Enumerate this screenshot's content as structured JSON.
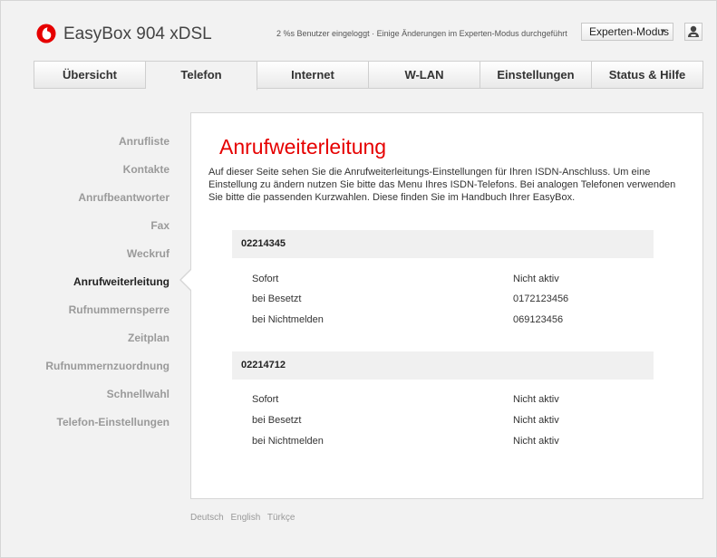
{
  "header": {
    "title": "EasyBox 904 xDSL",
    "status_text": "2 %s Benutzer eingeloggt · Einige Änderungen im Experten-Modus durchgeführt",
    "mode_select": "Experten-Modus",
    "brand_color": "#e60000"
  },
  "tabs": [
    {
      "label": "Übersicht"
    },
    {
      "label": "Telefon"
    },
    {
      "label": "Internet"
    },
    {
      "label": "W-LAN"
    },
    {
      "label": "Einstellungen"
    },
    {
      "label": "Status & Hilfe"
    }
  ],
  "active_tab": "Telefon",
  "sidebar": {
    "items": [
      {
        "label": "Anrufliste"
      },
      {
        "label": "Kontakte"
      },
      {
        "label": "Anrufbeantworter"
      },
      {
        "label": "Fax"
      },
      {
        "label": "Weckruf"
      },
      {
        "label": "Anrufweiterleitung"
      },
      {
        "label": "Rufnummernsperre"
      },
      {
        "label": "Zeitplan"
      },
      {
        "label": "Rufnummernzuordnung"
      },
      {
        "label": "Schnellwahl"
      },
      {
        "label": "Telefon-Einstellungen"
      }
    ],
    "active": "Anrufweiterleitung"
  },
  "main": {
    "title": "Anrufweiterleitung",
    "description": "Auf dieser Seite sehen Sie die Anrufweiterleitungs-Einstellungen für Ihren ISDN-Anschluss. Um eine Einstellung zu ändern nutzen Sie bitte das Menu Ihres ISDN-Telefons. Bei analogen Telefonen verwenden Sie bitte die passenden Kurzwahlen. Diese finden Sie im Handbuch Ihrer EasyBox.",
    "groups": [
      {
        "number": "02214345",
        "rows": [
          {
            "label": "Sofort",
            "value": "Nicht aktiv"
          },
          {
            "label": "bei Besetzt",
            "value": "0172123456"
          },
          {
            "label": "bei Nichtmelden",
            "value": "069123456"
          }
        ]
      },
      {
        "number": "02214712",
        "rows": [
          {
            "label": "Sofort",
            "value": "Nicht aktiv"
          },
          {
            "label": "bei Besetzt",
            "value": "Nicht aktiv"
          },
          {
            "label": "bei Nichtmelden",
            "value": "Nicht aktiv"
          }
        ]
      }
    ]
  },
  "footer": {
    "languages": [
      "Deutsch",
      "English",
      "Türkçe"
    ]
  }
}
